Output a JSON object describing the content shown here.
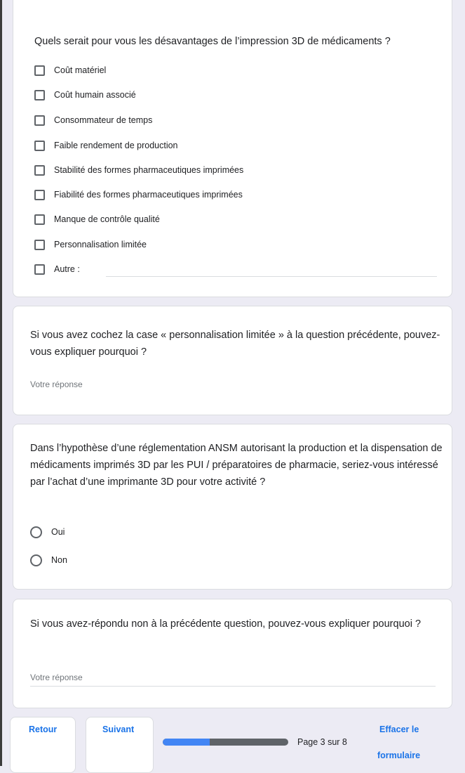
{
  "q1": {
    "title": "Quels serait pour vous les désavantages de l’impression 3D de médicaments ?",
    "options": [
      "Coût matériel",
      "Coût humain associé",
      "Consommateur de temps",
      "Faible rendement de production",
      "Stabilité des formes pharmaceutiques imprimées",
      "Fiabilité des formes pharmaceutiques imprimées",
      "Manque de contrôle qualité",
      "Personnalisation limitée",
      "Autre :"
    ]
  },
  "q2": {
    "title": "Si vous avez cochez la case « personnalisation limitée » à la question précédente, pouvez-vous expliquer pourquoi ?",
    "placeholder": "Votre réponse"
  },
  "q3": {
    "title": "Dans l’hypothèse d’une réglementation ANSM autorisant la production et la dispensation de médicaments imprimés 3D par les PUI / préparatoires de pharmacie, seriez-vous intéressé par l’achat d’une imprimante 3D pour votre activité ?",
    "options": [
      "Oui",
      "Non"
    ]
  },
  "q4": {
    "title": "Si vous avez-répondu non à la précédente question, pouvez-vous expliquer pourquoi ?",
    "placeholder": "Votre réponse"
  },
  "nav": {
    "back_label": "Retour",
    "next_label": "Suivant",
    "clear_label_line1": "Effacer le",
    "clear_label_line2": "formulaire",
    "page_label": "Page 3 sur 8",
    "progress_fraction": 0.375
  },
  "colors": {
    "accent": "#1a73e8",
    "progress_fill": "#4285f4",
    "progress_track": "#5f6368",
    "page_background": "#ecebf4"
  }
}
